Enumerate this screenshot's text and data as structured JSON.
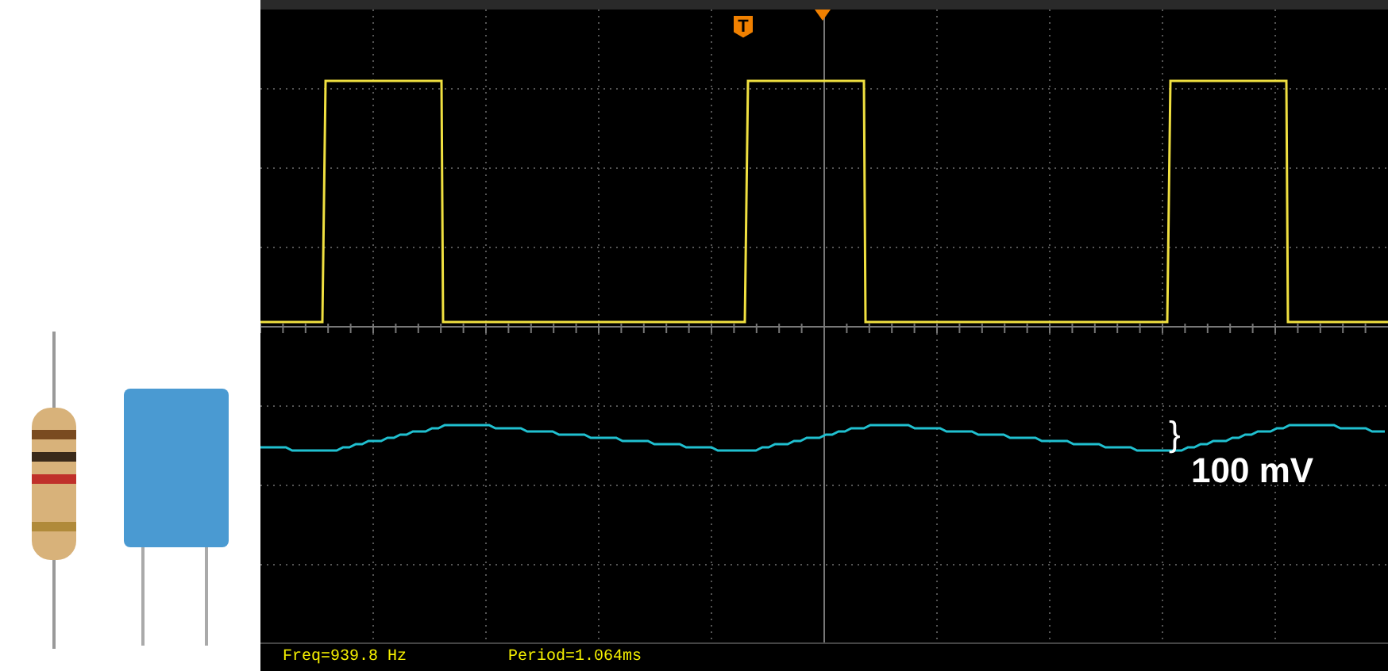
{
  "scope": {
    "trigger_marker": {
      "label": "T"
    },
    "annotation": {
      "brace": "}",
      "label": "100 mV"
    },
    "status_bar": [
      {
        "text": "Freq=939.8 Hz"
      },
      {
        "text": "Period=1.064ms"
      }
    ]
  }
}
